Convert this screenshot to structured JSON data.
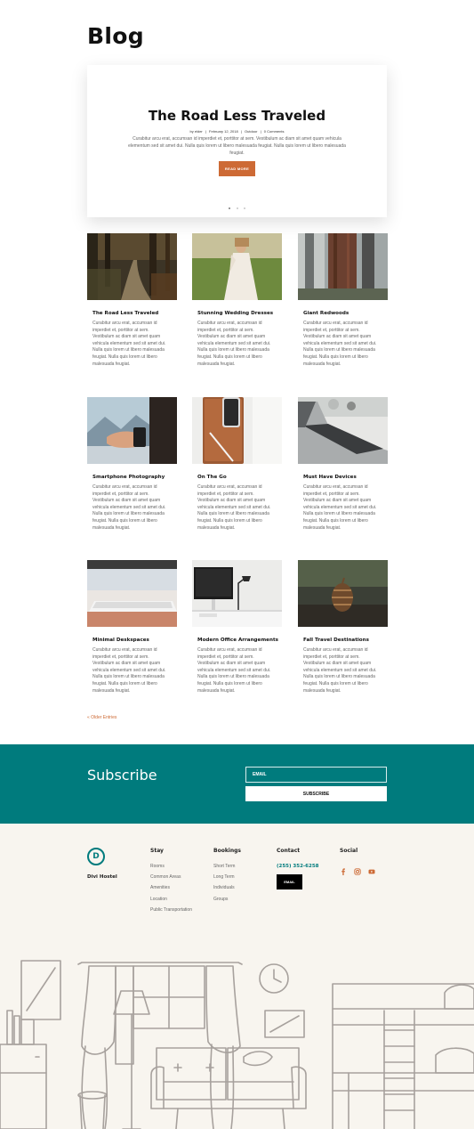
{
  "page": {
    "title": "Blog"
  },
  "featured": {
    "title": "The Road Less Traveled",
    "meta": {
      "by": "by elder",
      "sep1": "|",
      "date": "February 12, 2018",
      "sep2": "|",
      "category": "Outdoor",
      "sep3": "|",
      "comments": "0 Comments"
    },
    "excerpt": "Curabitur arcu erat, accumsan id imperdiet et, porttitor at sem. Vestibulum ac diam sit amet quam vehicula elementum sed sit amet dui. Nulla quis lorem ut libero malesuada feugiat. Nulla quis lorem ut libero malesuada feugiat.",
    "button": "READ MORE"
  },
  "posts": [
    {
      "title": "The Road Less Traveled",
      "excerpt": "Curabitur arcu erat, accumsan id imperdiet et, porttitor at sem. Vestibulum ac diam sit amet quam vehicula elementum sed sit amet dui. Nulla quis lorem ut libero malesuada feugiat. Nulla quis lorem ut libero malesuada feugiat."
    },
    {
      "title": "Stunning Wedding Dresses",
      "excerpt": "Curabitur arcu erat, accumsan id imperdiet et, porttitor at sem. Vestibulum ac diam sit amet quam vehicula elementum sed sit amet dui. Nulla quis lorem ut libero malesuada feugiat. Nulla quis lorem ut libero malesuada feugiat."
    },
    {
      "title": "Giant Redwoods",
      "excerpt": "Curabitur arcu erat, accumsan id imperdiet et, porttitor at sem. Vestibulum ac diam sit amet quam vehicula elementum sed sit amet dui. Nulla quis lorem ut libero malesuada feugiat. Nulla quis lorem ut libero malesuada feugiat."
    },
    {
      "title": "Smartphone Photography",
      "excerpt": "Curabitur arcu erat, accumsan id imperdiet et, porttitor at sem. Vestibulum ac diam sit amet quam vehicula elementum sed sit amet dui. Nulla quis lorem ut libero malesuada feugiat. Nulla quis lorem ut libero malesuada feugiat."
    },
    {
      "title": "On The Go",
      "excerpt": "Curabitur arcu erat, accumsan id imperdiet et, porttitor at sem. Vestibulum ac diam sit amet quam vehicula elementum sed sit amet dui. Nulla quis lorem ut libero malesuada feugiat. Nulla quis lorem ut libero malesuada feugiat."
    },
    {
      "title": "Must Have Devices",
      "excerpt": "Curabitur arcu erat, accumsan id imperdiet et, porttitor at sem. Vestibulum ac diam sit amet quam vehicula elementum sed sit amet dui. Nulla quis lorem ut libero malesuada feugiat. Nulla quis lorem ut libero malesuada feugiat."
    },
    {
      "title": "Minimal Deskspaces",
      "excerpt": "Curabitur arcu erat, accumsan id imperdiet et, porttitor at sem. Vestibulum ac diam sit amet quam vehicula elementum sed sit amet dui. Nulla quis lorem ut libero malesuada feugiat. Nulla quis lorem ut libero malesuada feugiat."
    },
    {
      "title": "Modern Office Arrangements",
      "excerpt": "Curabitur arcu erat, accumsan id imperdiet et, porttitor at sem. Vestibulum ac diam sit amet quam vehicula elementum sed sit amet dui. Nulla quis lorem ut libero malesuada feugiat. Nulla quis lorem ut libero malesuada feugiat."
    },
    {
      "title": "Fall Travel Destinations",
      "excerpt": "Curabitur arcu erat, accumsan id imperdiet et, porttitor at sem. Vestibulum ac diam sit amet quam vehicula elementum sed sit amet dui. Nulla quis lorem ut libero malesuada feugiat. Nulla quis lorem ut libero malesuada feugiat."
    }
  ],
  "pagination": {
    "older": "« Older Entries"
  },
  "subscribe": {
    "title": "Subscribe",
    "email_placeholder": "EMAIL",
    "button": "SUBSCRIBE"
  },
  "footer": {
    "logo_letter": "D",
    "brand": "Divi Hostel",
    "stay": {
      "heading": "Stay",
      "links": [
        "Rooms",
        "Common Areas",
        "Amenities",
        "Location",
        "Public Transportation"
      ]
    },
    "bookings": {
      "heading": "Bookings",
      "links": [
        "Short Term",
        "Long Term",
        "Individuals",
        "Groups"
      ]
    },
    "contact": {
      "heading": "Contact",
      "phone": "(255) 352-6258",
      "email_button": "EMAIL"
    },
    "social": {
      "heading": "Social",
      "icons": [
        "facebook-icon",
        "instagram-icon",
        "youtube-icon"
      ]
    }
  },
  "colors": {
    "accent": "#cd6a35",
    "teal": "#007b7d",
    "footer_bg": "#f8f5ef"
  }
}
